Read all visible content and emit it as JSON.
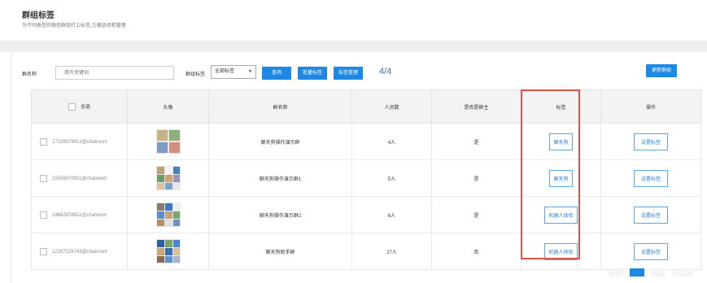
{
  "page": {
    "title": "群组标签",
    "subtitle": "为不同类型的微信群组打上标签,方便选择和管理"
  },
  "filters": {
    "group_name_label": "群名称",
    "group_name_placeholder": "填写关键词",
    "tag_label": "群组标签",
    "tag_select_value": "全部标签",
    "tag_select_arrow": "▼",
    "search_button": "查询",
    "batch_tag_button": "批量标签",
    "tag_manage_button": "标签管理",
    "page_count": "4/4",
    "update_button": "更新群组"
  },
  "table": {
    "headers": {
      "select_all": "全选",
      "avatar": "头像",
      "group_name": "群名称",
      "members": "人员数",
      "is_owner": "是否是群主",
      "tag": "标签",
      "action": "操作"
    },
    "rows": [
      {
        "id": "17239979912@chatroom",
        "name": "聊天狗操作演示群",
        "members": "4人",
        "owner": "是",
        "tag": "聊天狗",
        "action": "设置标签"
      },
      {
        "id": "15556670911@chatroom",
        "name": "聊天狗操作演示群1",
        "members": "5人",
        "owner": "是",
        "tag": "聊天狗",
        "action": "设置标签"
      },
      {
        "id": "19682878811@chatroom",
        "name": "聊天狗操作演示群2",
        "members": "6人",
        "owner": "是",
        "tag": "机器人体验",
        "action": "设置标签"
      },
      {
        "id": "12267226743@chatroom",
        "name": "聊天狗助手群",
        "members": "27人",
        "owner": "否",
        "tag": "机器人体验",
        "action": "设置标签"
      }
    ]
  },
  "colors": {
    "primary": "#1e88e5",
    "highlight": "#d9534f"
  }
}
